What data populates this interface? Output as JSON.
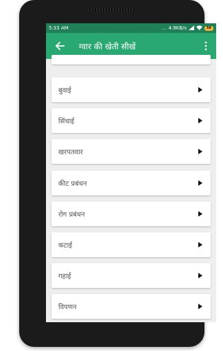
{
  "status_bar": {
    "time": "5:33 AM",
    "dots": "...",
    "speed": "4.9KB/s",
    "battery": "56"
  },
  "app_bar": {
    "title": "ग्वार की खेती सीखें",
    "back_icon": "arrow-back-icon",
    "menu_icon": "more-vert-icon"
  },
  "list": {
    "items": [
      {
        "label": "बुवाई"
      },
      {
        "label": "सिंचाई"
      },
      {
        "label": "खरपतवार"
      },
      {
        "label": "कीट प्रबंधन"
      },
      {
        "label": "रोग प्रबंधन"
      },
      {
        "label": "कटाई"
      },
      {
        "label": "गहाई"
      },
      {
        "label": "विपणन"
      }
    ]
  },
  "colors": {
    "status_bar": "#1f7f56",
    "app_bar": "#2aa871",
    "background": "#eeeeee"
  }
}
